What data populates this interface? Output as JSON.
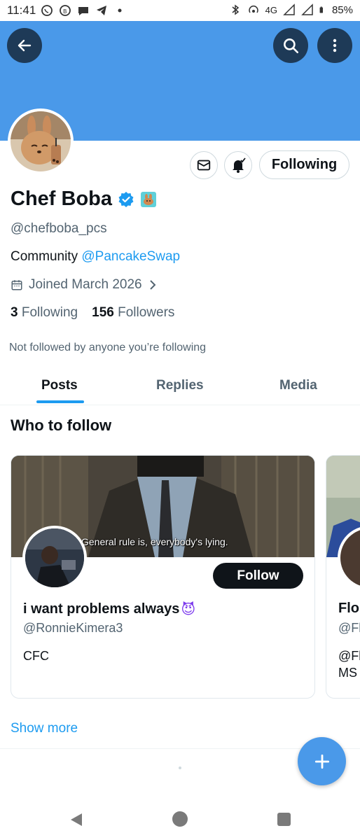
{
  "status_bar": {
    "time": "11:41",
    "network": "4G",
    "battery": "85%"
  },
  "header": {
    "back_icon": "arrow-left-icon",
    "search_icon": "search-icon",
    "more_icon": "more-vertical-icon",
    "banner_color": "#4a99e9"
  },
  "profile": {
    "display_name": "Chef Boba",
    "handle": "@chefboba_pcs",
    "bio_prefix": "Community ",
    "bio_mention": "@PancakeSwap",
    "joined": "Joined March 2026",
    "following_count": "3",
    "following_label": "Following",
    "followers_count": "156",
    "followers_label": "Followers",
    "not_followed_note": "Not followed by anyone you’re following",
    "following_button": "Following"
  },
  "tabs": [
    {
      "label": "Posts",
      "active": true
    },
    {
      "label": "Replies",
      "active": false
    },
    {
      "label": "Media",
      "active": false
    }
  ],
  "who_to_follow": {
    "title": "Who to follow",
    "cards": [
      {
        "caption": "General rule is, everybody's lying.",
        "follow_label": "Follow",
        "name": "i want problems always",
        "emoji": "😈",
        "handle": "@RonnieKimera3",
        "bio": "CFC"
      },
      {
        "name": "Flor",
        "handle": "@Fl",
        "bio_line1": "@Fl",
        "bio_line2": "MS"
      }
    ],
    "show_more": "Show more"
  },
  "fab": {
    "icon": "plus-icon"
  },
  "accent_color": "#1d9bf0"
}
